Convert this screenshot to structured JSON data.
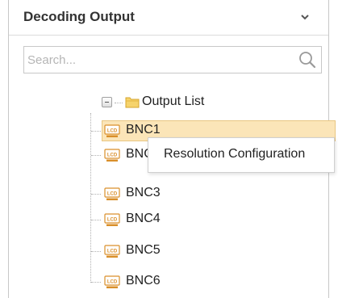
{
  "panel": {
    "title": "Decoding Output",
    "collapse_icon": "chevron-down-icon"
  },
  "search": {
    "placeholder": "Search...",
    "value": "",
    "icon": "search-icon"
  },
  "tree": {
    "root": {
      "label": "Output List",
      "expanded": true,
      "icon": "folder-icon"
    },
    "items": [
      {
        "label": "BNC1",
        "selected": true,
        "icon": "lcd-icon"
      },
      {
        "label": "BNC2",
        "selected": false,
        "icon": "lcd-icon"
      },
      {
        "label": "BNC3",
        "selected": false,
        "icon": "lcd-icon"
      },
      {
        "label": "BNC4",
        "selected": false,
        "icon": "lcd-icon"
      },
      {
        "label": "BNC5",
        "selected": false,
        "icon": "lcd-icon"
      },
      {
        "label": "BNC6",
        "selected": false,
        "icon": "lcd-icon"
      }
    ]
  },
  "context_menu": {
    "items": [
      {
        "label": "Resolution Configuration"
      }
    ]
  },
  "colors": {
    "selected_bg": "#fbe5b8",
    "selected_border": "#e9c681",
    "folder": "#f3c24f",
    "lcd_icon": "#d98f2a"
  }
}
